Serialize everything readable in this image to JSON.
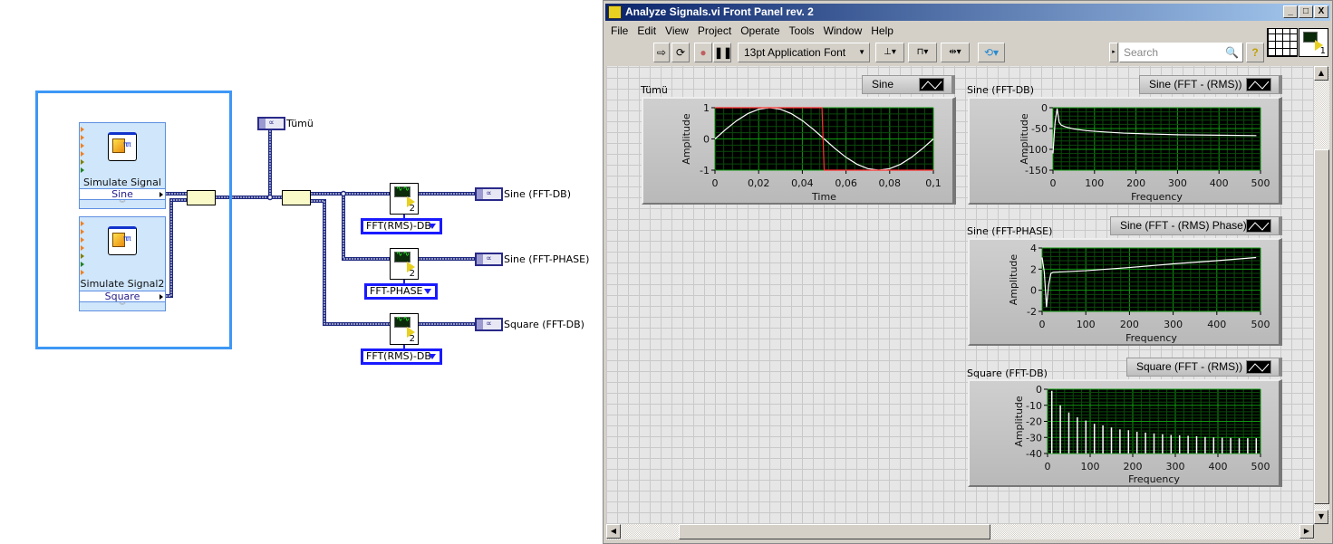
{
  "block_diagram": {
    "simulate_signal_1": {
      "title": "Simulate Signal",
      "value": "Sine"
    },
    "simulate_signal_2": {
      "title": "Simulate Signal2",
      "value": "Square"
    },
    "indicator_all": "Tümü",
    "analysis": [
      {
        "mode": "FFT(RMS)-DB",
        "output": "Sine (FFT-DB)",
        "count": "2"
      },
      {
        "mode": "FFT-PHASE",
        "output": "Sine (FFT-PHASE)",
        "count": "2"
      },
      {
        "mode": "FFT(RMS)-DB",
        "output": "Square (FFT-DB)",
        "count": "2"
      }
    ],
    "wire_color": "#1f2a80",
    "structure_color": "#3d97f5"
  },
  "window": {
    "title": "Analyze Signals.vi Front Panel rev. 2",
    "controls": [
      "_",
      "□",
      "X"
    ],
    "menu": [
      "File",
      "Edit",
      "View",
      "Project",
      "Operate",
      "Tools",
      "Window",
      "Help"
    ],
    "toolbar": {
      "run_icon": "run-arrow-icon",
      "run_continuous_icon": "run-continuously-icon",
      "abort_icon": "abort-icon",
      "pause_icon": "pause-icon",
      "font": "13pt Application Font",
      "search_placeholder": "Search",
      "help": "?",
      "vi_icon_number": "1"
    }
  },
  "chart_data": [
    {
      "type": "line",
      "label": "Tümü",
      "legend": "Sine",
      "xlabel": "Time",
      "ylabel": "Amplitude",
      "xlim": [
        0,
        0.1
      ],
      "ylim": [
        -1,
        1
      ],
      "xticks": [
        "0",
        "0,02",
        "0,04",
        "0,06",
        "0,08",
        "0,1"
      ],
      "xtick_values": [
        0,
        0.02,
        0.04,
        0.06,
        0.08,
        0.1
      ],
      "yticks": [
        "1",
        "0",
        "-1"
      ],
      "ytick_values": [
        1,
        0,
        -1
      ],
      "grid": true,
      "series": [
        {
          "color": "#ffffff",
          "points": [
            [
              0,
              0
            ],
            [
              0.005,
              0.309
            ],
            [
              0.01,
              0.588
            ],
            [
              0.015,
              0.809
            ],
            [
              0.02,
              0.951
            ],
            [
              0.025,
              1
            ],
            [
              0.03,
              0.951
            ],
            [
              0.035,
              0.809
            ],
            [
              0.04,
              0.588
            ],
            [
              0.045,
              0.309
            ],
            [
              0.05,
              0
            ],
            [
              0.055,
              -0.309
            ],
            [
              0.06,
              -0.588
            ],
            [
              0.065,
              -0.809
            ],
            [
              0.07,
              -0.951
            ],
            [
              0.075,
              -1
            ],
            [
              0.08,
              -0.951
            ],
            [
              0.085,
              -0.809
            ],
            [
              0.09,
              -0.588
            ],
            [
              0.095,
              -0.309
            ],
            [
              0.1,
              0
            ]
          ]
        },
        {
          "color": "#ff3030",
          "points": [
            [
              0,
              1
            ],
            [
              0.049,
              1
            ],
            [
              0.05,
              -1
            ],
            [
              0.1,
              -1
            ]
          ]
        }
      ]
    },
    {
      "type": "line",
      "label": "Sine (FFT-DB)",
      "legend": "Sine (FFT - (RMS))",
      "xlabel": "Frequency",
      "ylabel": "Amplitude",
      "xlim": [
        0,
        500
      ],
      "ylim": [
        -150,
        0
      ],
      "xticks": [
        "0",
        "100",
        "200",
        "300",
        "400",
        "500"
      ],
      "xtick_values": [
        0,
        100,
        200,
        300,
        400,
        500
      ],
      "yticks": [
        "0",
        "-50",
        "-100",
        "-150"
      ],
      "ytick_values": [
        0,
        -50,
        -100,
        -150
      ],
      "grid": true,
      "series": [
        {
          "color": "#ffffff",
          "points": [
            [
              0,
              -110
            ],
            [
              5,
              -35
            ],
            [
              10,
              -2
            ],
            [
              15,
              -35
            ],
            [
              20,
              -42
            ],
            [
              30,
              -46
            ],
            [
              50,
              -51
            ],
            [
              80,
              -55
            ],
            [
              120,
              -58
            ],
            [
              170,
              -61
            ],
            [
              230,
              -63
            ],
            [
              300,
              -65
            ],
            [
              400,
              -66
            ],
            [
              490,
              -67
            ]
          ]
        }
      ]
    },
    {
      "type": "line",
      "label": "Sine (FFT-PHASE)",
      "legend": "Sine (FFT - (RMS) Phase)",
      "xlabel": "Frequency",
      "ylabel": "Amplitude",
      "xlim": [
        0,
        500
      ],
      "ylim": [
        -2,
        4
      ],
      "xticks": [
        "0",
        "100",
        "200",
        "300",
        "400",
        "500"
      ],
      "xtick_values": [
        0,
        100,
        200,
        300,
        400,
        500
      ],
      "yticks": [
        "4",
        "2",
        "0",
        "-2"
      ],
      "ytick_values": [
        4,
        2,
        0,
        -2
      ],
      "grid": true,
      "series": [
        {
          "color": "#ffffff",
          "points": [
            [
              0,
              3.1
            ],
            [
              5,
              1.7
            ],
            [
              10,
              -1.6
            ],
            [
              15,
              0.5
            ],
            [
              20,
              1.6
            ],
            [
              25,
              1.7
            ],
            [
              100,
              1.85
            ],
            [
              200,
              2.15
            ],
            [
              300,
              2.5
            ],
            [
              400,
              2.8
            ],
            [
              490,
              3.1
            ]
          ]
        }
      ]
    },
    {
      "type": "bar",
      "label": "Square (FFT-DB)",
      "legend": "Square (FFT - (RMS))",
      "xlabel": "Frequency",
      "ylabel": "Amplitude",
      "xlim": [
        0,
        500
      ],
      "ylim": [
        -40,
        0
      ],
      "xticks": [
        "0",
        "100",
        "200",
        "300",
        "400",
        "500"
      ],
      "xtick_values": [
        0,
        100,
        200,
        300,
        400,
        500
      ],
      "yticks": [
        "0",
        "-10",
        "-20",
        "-30",
        "-40"
      ],
      "ytick_values": [
        0,
        -10,
        -20,
        -30,
        -40
      ],
      "grid": true,
      "series": [
        {
          "color": "#ffffff",
          "points": [
            [
              10,
              -1
            ],
            [
              30,
              -10
            ],
            [
              50,
              -14.5
            ],
            [
              70,
              -17.5
            ],
            [
              90,
              -19.5
            ],
            [
              110,
              -21.5
            ],
            [
              130,
              -22.5
            ],
            [
              150,
              -23.8
            ],
            [
              170,
              -25
            ],
            [
              190,
              -25.5
            ],
            [
              210,
              -26.5
            ],
            [
              230,
              -27
            ],
            [
              250,
              -27.5
            ],
            [
              270,
              -28
            ],
            [
              290,
              -28.5
            ],
            [
              310,
              -28.7
            ],
            [
              330,
              -29
            ],
            [
              350,
              -29.3
            ],
            [
              370,
              -29.7
            ],
            [
              390,
              -30
            ],
            [
              410,
              -30.2
            ],
            [
              430,
              -30.3
            ],
            [
              450,
              -30.5
            ],
            [
              470,
              -30.5
            ],
            [
              490,
              -30.5
            ]
          ]
        }
      ]
    }
  ]
}
